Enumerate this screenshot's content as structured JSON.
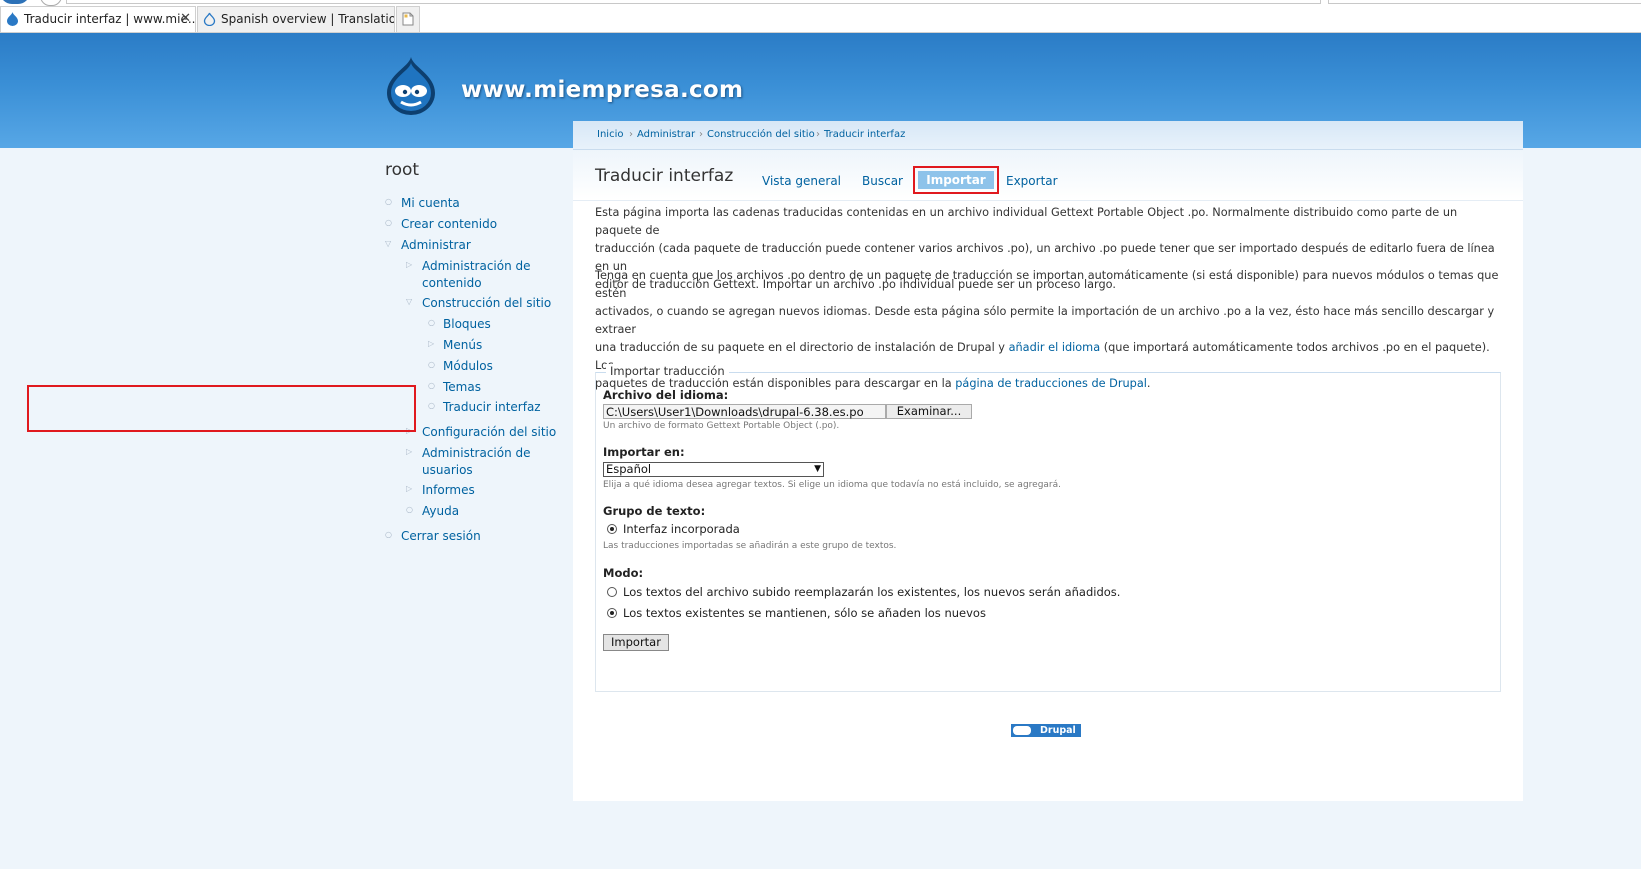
{
  "browser": {
    "tabs": [
      {
        "title": "Traducir interfaz | www.mie...",
        "close": "✕"
      },
      {
        "title": "Spanish overview | Translations"
      }
    ]
  },
  "site": {
    "name": "www.miempresa.com"
  },
  "sidebar": {
    "user": "root",
    "items": [
      "Mi cuenta",
      "Crear contenido",
      "Administrar",
      "Administración de",
      "contenido",
      "Construcción del sitio",
      "Bloques",
      "Menús",
      "Módulos",
      "Temas",
      "Traducir interfaz",
      "Configuración del sitio",
      "Administración de",
      "usuarios",
      "Informes",
      "Ayuda",
      "Cerrar sesión"
    ]
  },
  "breadcrumb": [
    "Inicio",
    "Administrar",
    "Construcción del sitio",
    "Traducir interfaz"
  ],
  "page": {
    "title": "Traducir interfaz",
    "tabs": [
      "Vista general",
      "Buscar",
      "Importar",
      "Exportar"
    ],
    "intro": [
      "Esta página importa las cadenas traducidas contenidas en un archivo individual Gettext Portable Object .po. Normalmente distribuido como parte de un paquete de",
      "traducción (cada paquete de traducción puede contener varios archivos .po), un archivo .po puede tener que ser importado después de editarlo fuera de línea en un",
      "editor de traducción Gettext. Importar un archivo .po individual puede ser un proceso largo."
    ],
    "note": [
      "Tenga en cuenta que los archivos .po dentro de un paquete de traducción se importan automáticamente (si está disponible) para nuevos módulos o temas que estén",
      "activados, o cuando se agregan nuevos idiomas. Desde esta página sólo permite la importación de un archivo .po a la vez, ésto hace más sencillo descargar y extraer",
      {
        "before": "una traducción de su paquete en el directorio de instalación de Drupal y ",
        "link": "añadir el idioma",
        "after": " (que importará automáticamente todos archivos .po en el paquete). Los"
      },
      {
        "before": "paquetes de traducción están disponibles para descargar en la ",
        "link": "página de traducciones de Drupal",
        "after": "."
      }
    ]
  },
  "form": {
    "legend": "Importar traducción",
    "file_label": "Archivo del idioma:",
    "file_value": "C:\\Users\\User1\\Downloads\\drupal-6.38.es.po",
    "browse": "Examinar...",
    "file_desc": "Un archivo de formato Gettext Portable Object (.po).",
    "lang_label": "Importar en:",
    "lang_value": "Español",
    "lang_desc": "Elija a qué idioma desea agregar textos. Si elige un idioma que todavía no está incluido, se agregará.",
    "group_label": "Grupo de texto:",
    "group_option": "Interfaz incorporada",
    "group_desc": "Las traducciones importadas se añadirán a este grupo de textos.",
    "mode_label": "Modo:",
    "mode_options": [
      "Los textos del archivo subido reemplazarán los existentes, los nuevos serán añadidos.",
      "Los textos existentes se mantienen, sólo se añaden los nuevos"
    ],
    "submit": "Importar"
  },
  "footer": {
    "badge": "Drupal"
  }
}
